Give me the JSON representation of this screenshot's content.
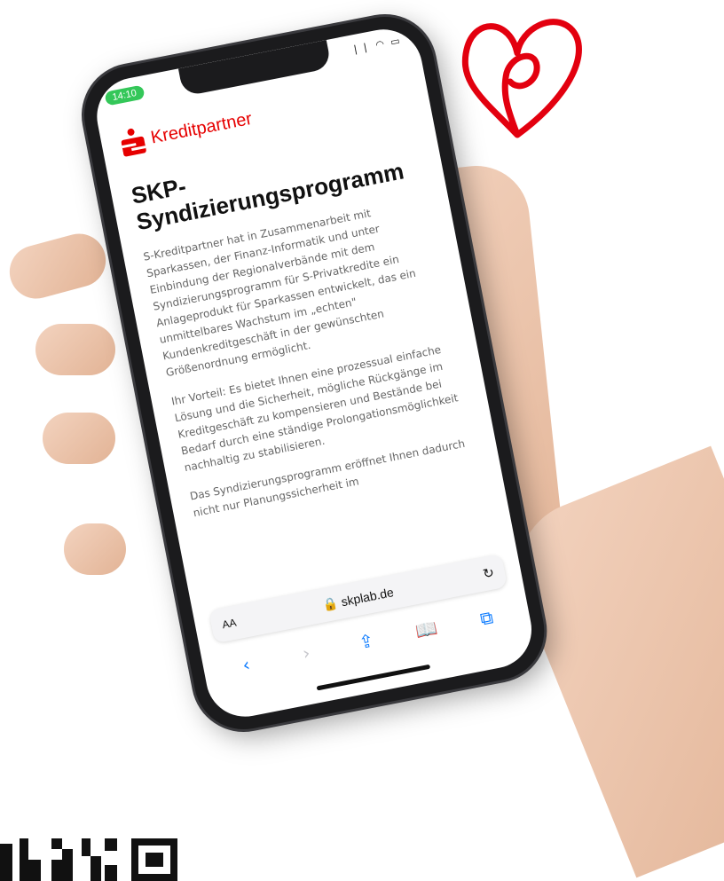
{
  "status_bar": {
    "time": "14:10",
    "icons": "❘❘ ◠ ▭"
  },
  "brand": {
    "name": "Kreditpartner",
    "color": "#e60000"
  },
  "page": {
    "title": "SKP-Syndizierungsprogramm",
    "paragraphs": [
      "S-Kreditpartner hat in Zusammenarbeit mit Sparkassen, der Finanz-Informatik und unter Einbindung der Regionalverbände mit dem Syndizierungsprogramm für S-Privatkredite ein Anlageprodukt für Sparkassen entwickelt, das ein unmittelbares Wachstum im „echten\" Kundenkreditgeschäft in der gewünschten Größenordnung ermöglicht.",
      "Ihr Vorteil: Es bietet Ihnen eine prozessual einfache Lösung und die Sicherheit, mögliche Rückgänge im Kreditgeschäft zu kompensieren und Bestände bei Bedarf durch eine ständige Prolongationsmöglichkeit nachhaltig zu stabilisieren.",
      "Das Syndizierungsprogramm eröffnet Ihnen dadurch nicht nur Planungssicherheit im"
    ]
  },
  "browser": {
    "text_size_label": "AA",
    "url": "skplab.de",
    "reload_icon": "reload-icon",
    "toolbar": [
      "back-icon",
      "forward-icon",
      "share-icon",
      "bookmarks-icon",
      "tabs-icon"
    ]
  },
  "colors": {
    "heart": "#e3000f",
    "ios_blue": "#0a7aff",
    "status_green": "#34c759"
  }
}
